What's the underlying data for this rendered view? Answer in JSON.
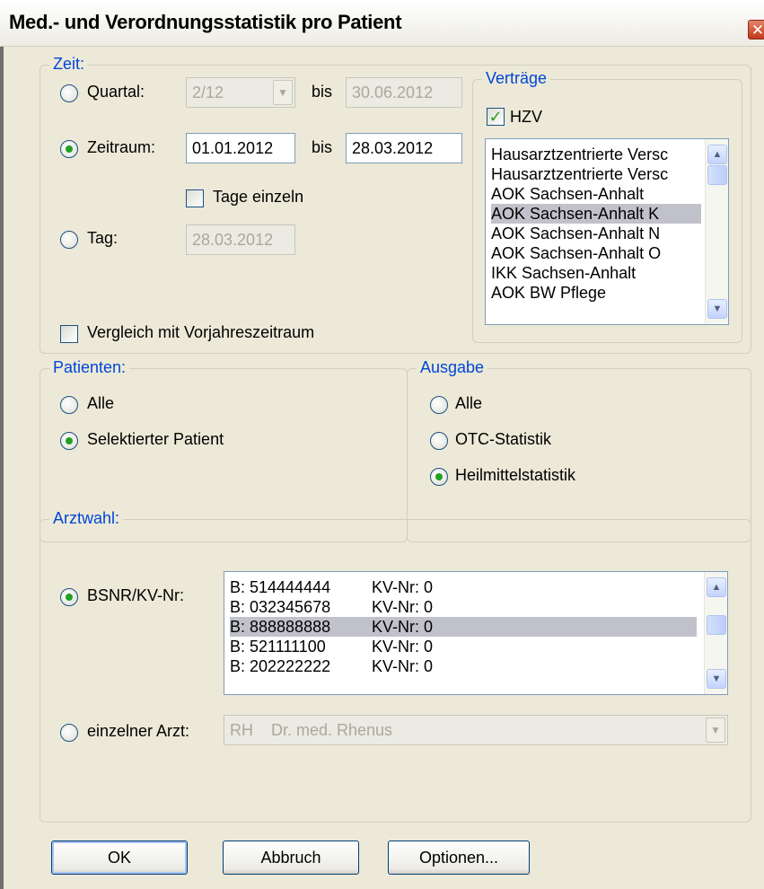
{
  "window": {
    "title": "Med.- und Verordnungsstatistik pro Patient",
    "close_glyph": "✕"
  },
  "zeit": {
    "legend": "Zeit:",
    "quartal": {
      "label": "Quartal:",
      "value": "2/12",
      "bis": "bis",
      "end": "30.06.2012"
    },
    "zeitraum": {
      "label": "Zeitraum:",
      "from": "01.01.2012",
      "bis": "bis",
      "to": "28.03.2012"
    },
    "tage_einzeln": "Tage einzeln",
    "tag": {
      "label": "Tag:",
      "value": "28.03.2012"
    },
    "vergleich": "Vergleich mit Vorjahreszeitraum",
    "selected_mode": "zeitraum"
  },
  "vertraege": {
    "legend": "Verträge",
    "hzv": {
      "label": "HZV",
      "checked": true
    },
    "items": [
      {
        "label": "Hausarztzentrierte Versc"
      },
      {
        "label": "Hausarztzentrierte Versc"
      },
      {
        "label": "AOK Sachsen-Anhalt"
      },
      {
        "label": "AOK Sachsen-Anhalt K",
        "selected": true
      },
      {
        "label": "AOK Sachsen-Anhalt N"
      },
      {
        "label": "AOK Sachsen-Anhalt O"
      },
      {
        "label": "IKK Sachsen-Anhalt"
      },
      {
        "label": "AOK BW Pflege"
      }
    ]
  },
  "patienten": {
    "legend": "Patienten:",
    "options": [
      {
        "label": "Alle"
      },
      {
        "label": "Selektierter Patient",
        "checked": true
      }
    ]
  },
  "ausgabe": {
    "legend": "Ausgabe",
    "options": [
      {
        "label": "Alle"
      },
      {
        "label": "OTC-Statistik"
      },
      {
        "label": "Heilmittelstatistik",
        "checked": true
      }
    ]
  },
  "arztwahl": {
    "legend": "Arztwahl:",
    "bsnr_label": "BSNR/KV-Nr:",
    "rows": [
      {
        "bsnr": "B: 514444444",
        "kv": "KV-Nr: 0"
      },
      {
        "bsnr": "B: 032345678",
        "kv": "KV-Nr: 0"
      },
      {
        "bsnr": "B: 888888888",
        "kv": "KV-Nr: 0",
        "selected": true
      },
      {
        "bsnr": "B: 521111100",
        "kv": "KV-Nr: 0"
      },
      {
        "bsnr": "B: 202222222",
        "kv": "KV-Nr: 0"
      }
    ],
    "einzelner_label": "einzelner Arzt:",
    "arzt": {
      "code": "RH",
      "name": "Dr. med. Rhenus"
    }
  },
  "buttons": {
    "ok": "OK",
    "abbruch": "Abbruch",
    "optionen": "Optionen..."
  }
}
